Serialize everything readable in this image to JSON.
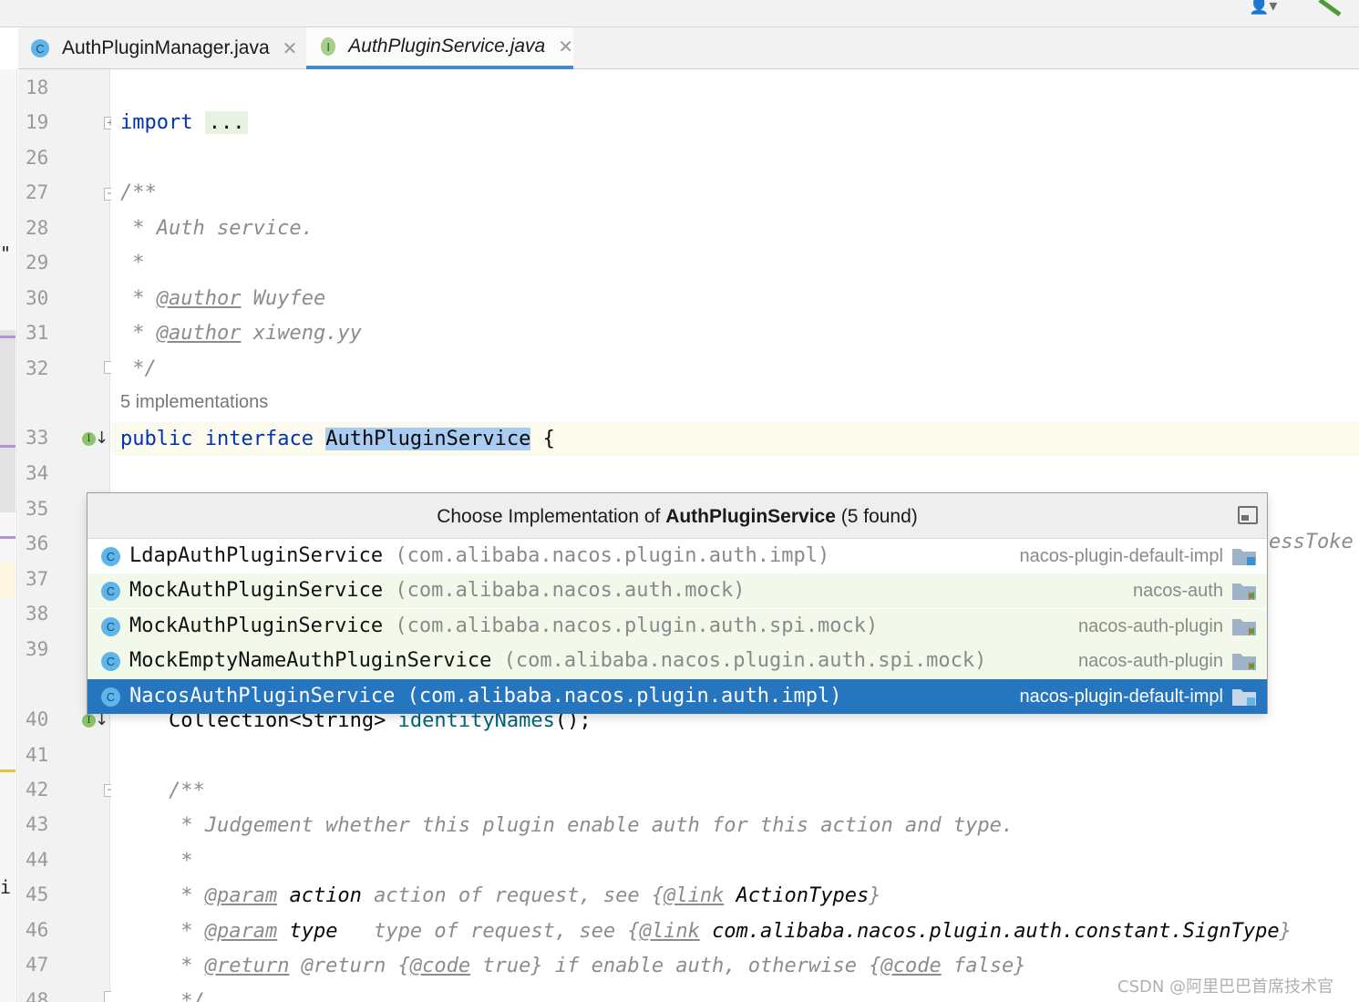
{
  "tabs": [
    {
      "label": "AuthPluginManager.java",
      "icon_letter": "C",
      "active": false
    },
    {
      "label": "AuthPluginService.java",
      "icon_letter": "I",
      "active": true
    }
  ],
  "gutter": {
    "line_numbers": [
      "18",
      "19",
      "26",
      "27",
      "28",
      "29",
      "30",
      "31",
      "32",
      "33",
      "34",
      "35",
      "36",
      "37",
      "38",
      "39",
      "40",
      "41",
      "42",
      "43",
      "44",
      "45",
      "46",
      "47",
      "48"
    ]
  },
  "editor": {
    "import_kw": "import",
    "import_fold": "...",
    "doc_open": "/**",
    "doc_desc": " * Auth service.",
    "doc_star": " *",
    "author_tag": "@author",
    "author1": "Wuyfee",
    "author2": "xiweng.yy",
    "doc_close": " */",
    "impl_hint": "5 implementations",
    "kw_public": "public",
    "kw_interface": "interface",
    "class_name": "AuthPluginService",
    "brace": "{",
    "line40": "    Collection<String> ",
    "line40_method": "identityNames",
    "line40_tail": "();",
    "doc2_open": "    /**",
    "doc2_desc": "     * Judgement whether this plugin enable auth for this action and type.",
    "doc2_star": "     *",
    "param_tag": "@param",
    "link_tag": "@link",
    "code_tag": "@code",
    "return_tag": "@return",
    "p1_name": "action",
    "p1_desc": " action of request, see {",
    "p1_link": "ActionTypes",
    "p2_name": "type",
    "p2_desc": "   type of request, see {",
    "p2_link": "com.alibaba.nacos.plugin.auth.constant.SignType",
    "ret_desc1": " @return {",
    "ret_true": " true}",
    "ret_desc2": " if enable auth, otherwise {",
    "ret_false": " false}",
    "doc2_close": "     */",
    "peek_text": "essToke"
  },
  "popup": {
    "title_prefix": "Choose Implementation of ",
    "title_name": "AuthPluginService",
    "title_suffix": " (5 found)",
    "items": [
      {
        "name": "LdapAuthPluginService",
        "package": " (com.alibaba.nacos.plugin.auth.impl)",
        "module": "nacos-plugin-default-impl",
        "selected": false
      },
      {
        "name": "MockAuthPluginService",
        "package": " (com.alibaba.nacos.auth.mock)",
        "module": "nacos-auth",
        "selected": false
      },
      {
        "name": "MockAuthPluginService",
        "package": " (com.alibaba.nacos.plugin.auth.spi.mock)",
        "module": "nacos-auth-plugin",
        "selected": false
      },
      {
        "name": "MockEmptyNameAuthPluginService",
        "package": " (com.alibaba.nacos.plugin.auth.spi.mock)",
        "module": "nacos-auth-plugin",
        "selected": false
      },
      {
        "name": "NacosAuthPluginService",
        "package": " (com.alibaba.nacos.plugin.auth.impl)",
        "module": "nacos-plugin-default-impl",
        "selected": true
      }
    ]
  },
  "watermark": "CSDN @阿里巴巴首席技术官",
  "colors": {
    "selection": "#2675bf",
    "keyword": "#0033b3",
    "comment": "#8c8c8c",
    "implemented_marker": "#8cc36b"
  }
}
